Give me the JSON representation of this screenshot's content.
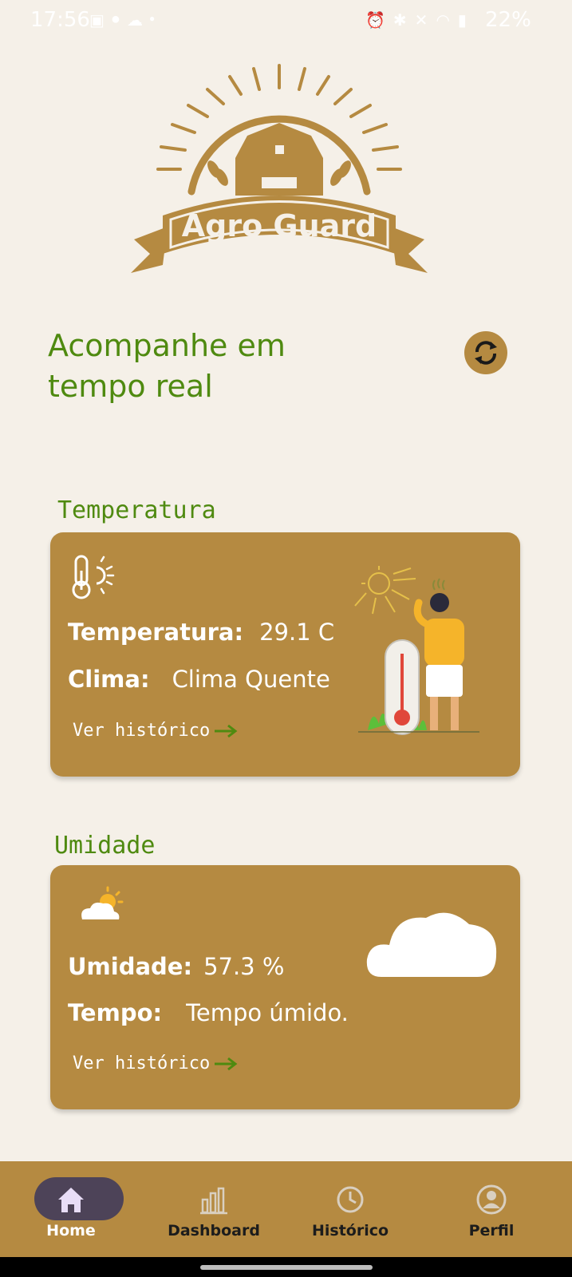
{
  "status_bar": {
    "time": "17:56",
    "battery": "22%",
    "left_icons": [
      "image-icon",
      "message-icon",
      "cloud-icon",
      "dot-icon"
    ],
    "right_icons": [
      "alarm-icon",
      "bluetooth-icon",
      "mute-icon",
      "wifi-icon",
      "signal-icon"
    ]
  },
  "logo": {
    "text": "Agro Guard"
  },
  "header": {
    "headline": "Acompanhe em tempo real"
  },
  "temperature": {
    "section_title": "Temperatura",
    "label": "Temperatura:",
    "value": "29.1 C",
    "climate_label": "Clima:",
    "climate_value": "Clima Quente",
    "link": "Ver histórico"
  },
  "humidity": {
    "section_title": "Umidade",
    "label": "Umidade:",
    "value": "57.3 %",
    "weather_label": "Tempo:",
    "weather_value": "Tempo úmido.",
    "link": "Ver histórico"
  },
  "nav": {
    "items": [
      {
        "label": "Home",
        "icon": "home-icon",
        "active": true
      },
      {
        "label": "Dashboard",
        "icon": "bar-chart-icon",
        "active": false
      },
      {
        "label": "Histórico",
        "icon": "clock-icon",
        "active": false
      },
      {
        "label": "Perfil",
        "icon": "profile-icon",
        "active": false
      }
    ]
  },
  "colors": {
    "background": "#f5f0e8",
    "accent_brown": "#b58a41",
    "green": "#4f8a10",
    "nav_active_pill": "#4d4358"
  }
}
